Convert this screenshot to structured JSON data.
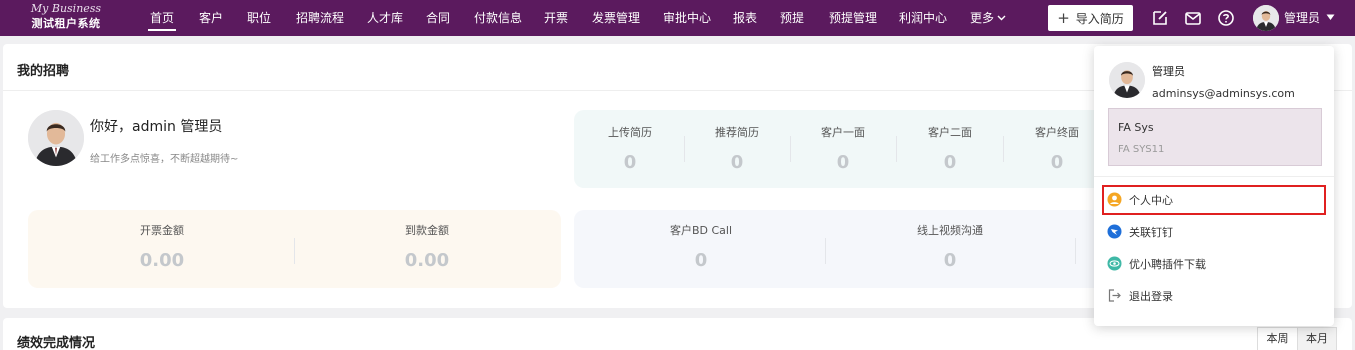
{
  "logo": {
    "line1": "My Business",
    "line2": "测试租户系统"
  },
  "nav": [
    "首页",
    "客户",
    "职位",
    "招聘流程",
    "人才库",
    "合同",
    "付款信息",
    "开票",
    "发票管理",
    "审批中心",
    "报表",
    "预提",
    "预提管理",
    "利润中心",
    "更多"
  ],
  "nav_active": "首页",
  "header": {
    "import_label": "导入简历",
    "user_name": "管理员",
    "icons": [
      "edit-icon",
      "mail-icon",
      "help-icon",
      "caret-down-icon"
    ]
  },
  "recruit": {
    "title": "我的招聘",
    "greeting": "你好，admin 管理员",
    "subtitle": "给工作多点惊喜，不断超越期待~",
    "stats1": [
      {
        "label": "上传简历",
        "value": "0"
      },
      {
        "label": "推荐简历",
        "value": "0"
      },
      {
        "label": "客户一面",
        "value": "0"
      },
      {
        "label": "客户二面",
        "value": "0"
      },
      {
        "label": "客户终面",
        "value": "0"
      }
    ],
    "stats2": [
      {
        "label": "开票金额",
        "value": "0.00"
      },
      {
        "label": "到款金额",
        "value": "0.00"
      }
    ],
    "stats3": [
      {
        "label": "客户BD Call",
        "value": "0"
      },
      {
        "label": "线上视频沟通",
        "value": "0"
      }
    ]
  },
  "performance": {
    "title": "绩效完成情况",
    "periods": [
      "本周",
      "本月"
    ]
  },
  "dropdown": {
    "name": "管理员",
    "email": "adminsys@adminsys.com",
    "tenant_name": "FA Sys",
    "tenant_code": "FA SYS11",
    "items": [
      {
        "label": "个人中心",
        "icon": "user-circle-icon"
      },
      {
        "label": "关联钉钉",
        "icon": "dingtalk-icon"
      },
      {
        "label": "优小聘插件下载",
        "icon": "plugin-icon"
      },
      {
        "label": "退出登录",
        "icon": "logout-icon"
      }
    ]
  },
  "colors": {
    "nav_bg": "#5b1a5e",
    "highlight": "#e02020",
    "stat_value": "#c4c8cc"
  }
}
